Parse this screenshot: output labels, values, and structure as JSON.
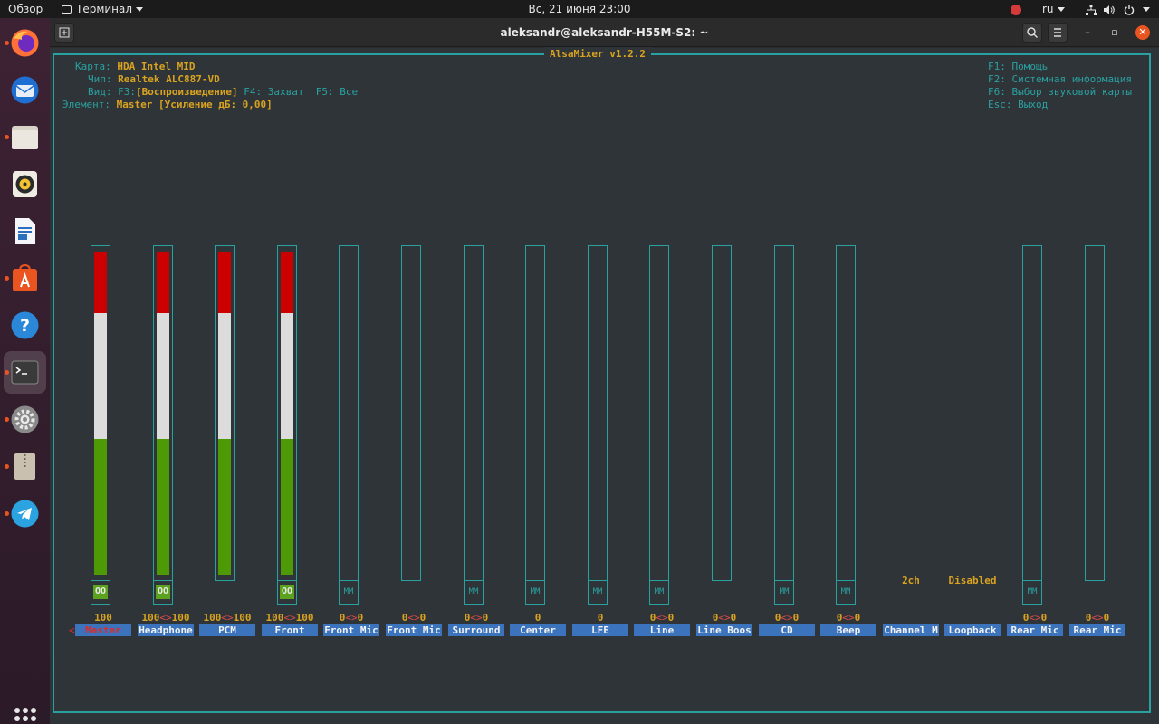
{
  "topbar": {
    "overview": "Обзор",
    "app_menu": "Терминал",
    "clock": "Вс, 21 июня  23:00",
    "lang": "ru"
  },
  "dock": {
    "items": [
      {
        "name": "firefox",
        "color": "#ff7139"
      },
      {
        "name": "thunderbird",
        "color": "#3b82d6"
      },
      {
        "name": "files",
        "color": "#d9d2c7"
      },
      {
        "name": "rhythmbox",
        "color": "#f1c232"
      },
      {
        "name": "writer",
        "color": "#2a6fbd"
      },
      {
        "name": "software",
        "color": "#e95420"
      },
      {
        "name": "help",
        "color": "#2b87d8"
      },
      {
        "name": "terminal",
        "color": "#3a3a3a"
      },
      {
        "name": "settings",
        "color": "#8a8a8a"
      },
      {
        "name": "archive",
        "color": "#c9c0b0"
      },
      {
        "name": "telegram",
        "color": "#2aa3e0"
      }
    ]
  },
  "window": {
    "title": "aleksandr@aleksandr-H55M-S2: ~"
  },
  "mixer": {
    "title": "AlsaMixer v1.2.2",
    "card_label": "Карта:",
    "card_value": "HDA Intel MID",
    "chip_label": "Чип:",
    "chip_value": "Realtek ALC887-VD",
    "view_label": "Вид:",
    "view_f3": "F3:",
    "view_f3_value": "[Воспроизведение]",
    "view_f4": "F4: Захват",
    "view_f5": "F5: Все",
    "element_label": "Элемент:",
    "element_value": "Master [Усиление дБ: 0,00]",
    "help": [
      "F1: Помощь",
      "F2: Системная информация",
      "F6: Выбор звуковой карты",
      "Esc: Выход"
    ],
    "selected_marker": "<",
    "controls": [
      {
        "name": "Master",
        "volume": 100,
        "vol_text": "100",
        "mute": "OO",
        "has_bar": true,
        "has_mute": true,
        "selected": true
      },
      {
        "name": "Headphone",
        "volume": 100,
        "vol_text": "100<>100",
        "mute": "OO",
        "has_bar": true,
        "has_mute": true
      },
      {
        "name": "PCM",
        "volume": 100,
        "vol_text": "100<>100",
        "mute": "",
        "has_bar": true,
        "has_mute": false
      },
      {
        "name": "Front",
        "volume": 100,
        "vol_text": "100<>100",
        "mute": "OO",
        "has_bar": true,
        "has_mute": true
      },
      {
        "name": "Front Mic",
        "volume": 0,
        "vol_text": "0<>0",
        "mute": "MM",
        "has_bar": true,
        "has_mute": true
      },
      {
        "name": "Front Mic",
        "volume": 0,
        "vol_text": "0<>0",
        "mute": "",
        "has_bar": true,
        "has_mute": false
      },
      {
        "name": "Surround",
        "volume": 0,
        "vol_text": "0<>0",
        "mute": "MM",
        "has_bar": true,
        "has_mute": true
      },
      {
        "name": "Center",
        "volume": 0,
        "vol_text": "0",
        "mute": "MM",
        "has_bar": true,
        "has_mute": true
      },
      {
        "name": "LFE",
        "volume": 0,
        "vol_text": "0",
        "mute": "MM",
        "has_bar": true,
        "has_mute": true
      },
      {
        "name": "Line",
        "volume": 0,
        "vol_text": "0<>0",
        "mute": "MM",
        "has_bar": true,
        "has_mute": true
      },
      {
        "name": "Line Boos",
        "volume": 0,
        "vol_text": "0<>0",
        "mute": "",
        "has_bar": true,
        "has_mute": false
      },
      {
        "name": "CD",
        "volume": 0,
        "vol_text": "0<>0",
        "mute": "MM",
        "has_bar": true,
        "has_mute": true
      },
      {
        "name": "Beep",
        "volume": 0,
        "vol_text": "0<>0",
        "mute": "MM",
        "has_bar": true,
        "has_mute": true
      },
      {
        "name": "Channel M",
        "volume": 0,
        "vol_text": "",
        "mute": "",
        "has_bar": false,
        "has_mute": false,
        "enum_value": "2ch"
      },
      {
        "name": "Loopback",
        "volume": 0,
        "vol_text": "",
        "mute": "",
        "has_bar": false,
        "has_mute": false,
        "enum_value": "Disabled"
      },
      {
        "name": "Rear Mic",
        "volume": 0,
        "vol_text": "0<>0",
        "mute": "MM",
        "has_bar": true,
        "has_mute": true
      },
      {
        "name": "Rear Mic",
        "volume": 0,
        "vol_text": "0<>0",
        "mute": "",
        "has_bar": true,
        "has_mute": false
      }
    ]
  },
  "colors": {
    "border": "#2aa1a1",
    "label": "#d9a320",
    "bar_red": "#cc0000",
    "bar_white": "#dcdcdc",
    "bar_green": "#4e9a06",
    "name_bg": "#3b74bd"
  }
}
